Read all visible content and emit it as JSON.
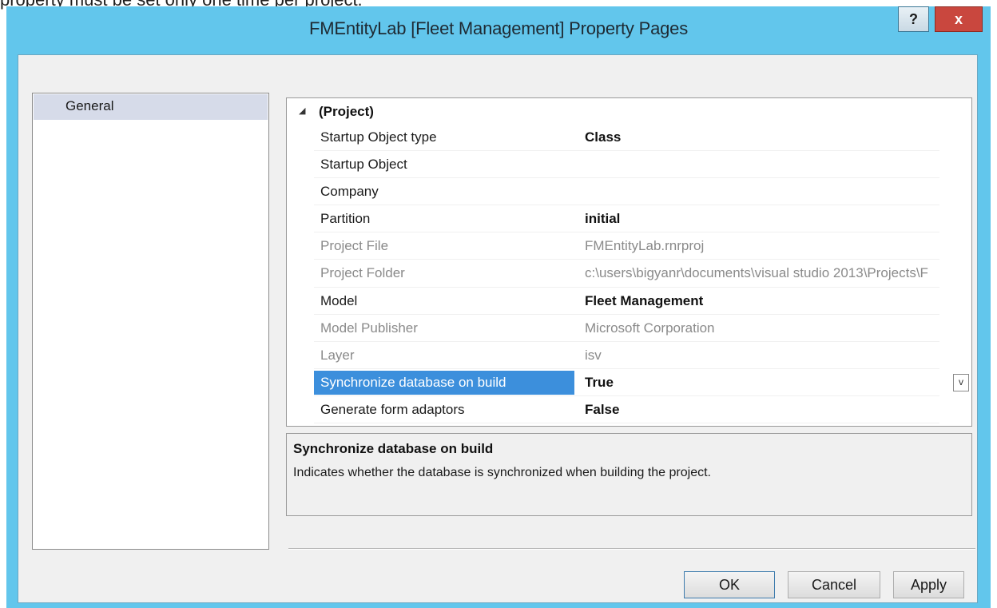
{
  "caption": "property must be set only one time per project.",
  "window": {
    "title": "FMEntityLab [Fleet Management] Property Pages",
    "help_label": "?",
    "close_label": "x"
  },
  "nav": {
    "items": [
      {
        "label": "General",
        "selected": true
      }
    ]
  },
  "grid": {
    "category": "(Project)",
    "collapse_glyph": "◢",
    "rows": [
      {
        "name": "Startup Object type",
        "value": "Class",
        "state": "normal"
      },
      {
        "name": "Startup Object",
        "value": "",
        "state": "normal"
      },
      {
        "name": "Company",
        "value": "",
        "state": "normal"
      },
      {
        "name": "Partition",
        "value": "initial",
        "state": "normal"
      },
      {
        "name": "Project File",
        "value": "FMEntityLab.rnrproj",
        "state": "readonly"
      },
      {
        "name": "Project Folder",
        "value": "c:\\users\\bigyanr\\documents\\visual studio 2013\\Projects\\F",
        "state": "readonly"
      },
      {
        "name": "Model",
        "value": "Fleet Management",
        "state": "normal"
      },
      {
        "name": "Model Publisher",
        "value": "Microsoft Corporation",
        "state": "readonly"
      },
      {
        "name": "Layer",
        "value": "isv",
        "state": "readonly"
      },
      {
        "name": "Synchronize database on build",
        "value": "True",
        "state": "selected"
      },
      {
        "name": "Generate form adaptors",
        "value": "False",
        "state": "normal"
      }
    ],
    "dropdown_glyph": "v"
  },
  "description": {
    "title": "Synchronize database on build",
    "text": "Indicates whether the database is synchronized when building the project."
  },
  "buttons": {
    "ok": "OK",
    "cancel": "Cancel",
    "apply": "Apply"
  },
  "colors": {
    "title_bar": "#62c6ec",
    "selection": "#3c8fdc",
    "close_button": "#c9473e",
    "nav_selected": "#d6dbe9"
  }
}
